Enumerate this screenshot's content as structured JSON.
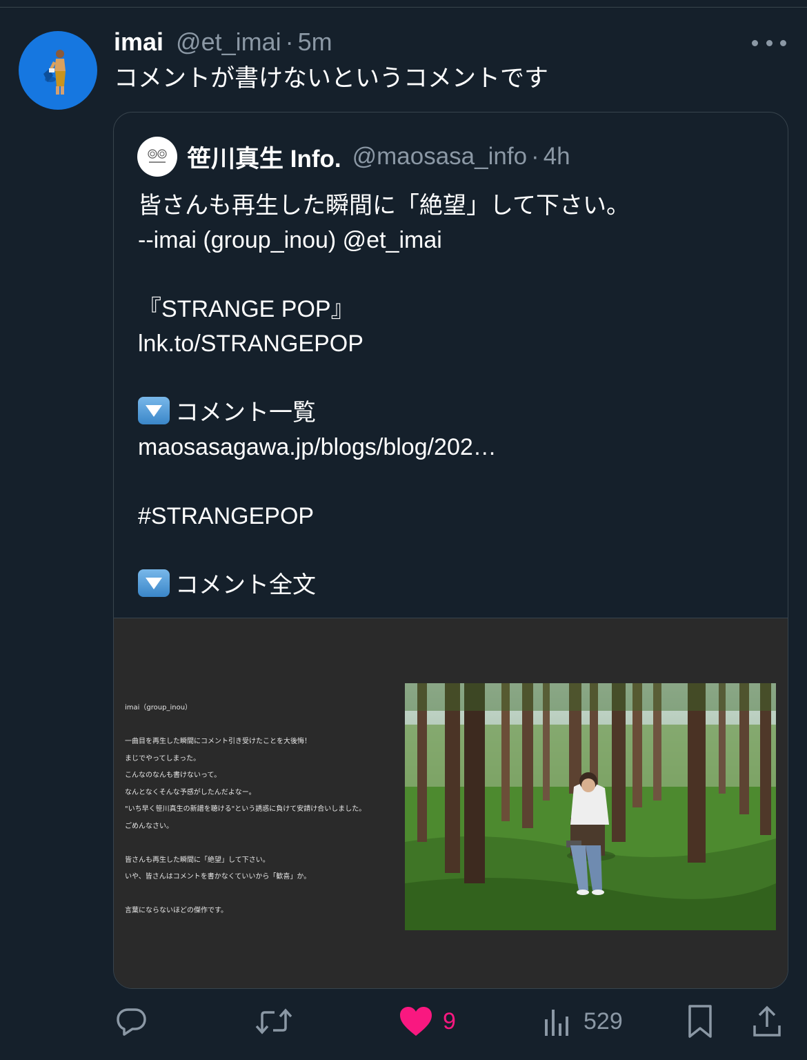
{
  "author": {
    "name": "imai",
    "handle": "@et_imai",
    "separator": "·",
    "time": "5m"
  },
  "tweet_text": "コメントが書けないというコメントです",
  "quoted": {
    "name": "笹川真生 Info.",
    "handle": "@maosasa_info",
    "separator": "·",
    "time": "4h",
    "lines": [
      "皆さんも再生した瞬間に「絶望」して下さい。",
      "--imai (group_inou) @et_imai",
      "",
      "『STRANGE POP』",
      "lnk.to/STRANGEPOP",
      "",
      "コメント一覧",
      "maosasagawa.jp/blogs/blog/202…",
      "",
      "#STRANGEPOP",
      "",
      "コメント全文"
    ],
    "media_lines": [
      "imai（group_inou）",
      "",
      "一曲目を再生した瞬間にコメント引き受けたことを大後悔！",
      "まじでやってしまった。",
      "こんなのなんも書けないって。",
      "なんとなくそんな予感がしたんだよなー。",
      "\"いち早く笹川真生の新譜を聴ける\"という誘惑に負けて安請け合いしました。",
      "ごめんなさい。",
      "",
      "皆さんも再生した瞬間に「絶望」して下さい。",
      "いや、皆さんはコメントを書かなくていいから「歓喜」か。",
      "",
      "言葉にならないほどの傑作です。"
    ]
  },
  "actions": {
    "reply_icon": "reply-icon",
    "retweet_icon": "retweet-icon",
    "like_icon": "heart-icon",
    "like_count": "9",
    "views_icon": "views-icon",
    "views_count": "529",
    "bookmark_icon": "bookmark-icon",
    "share_icon": "share-icon"
  },
  "colors": {
    "background": "#15202b",
    "muted": "#8b98a5",
    "like": "#f91880",
    "border": "#38444d"
  }
}
